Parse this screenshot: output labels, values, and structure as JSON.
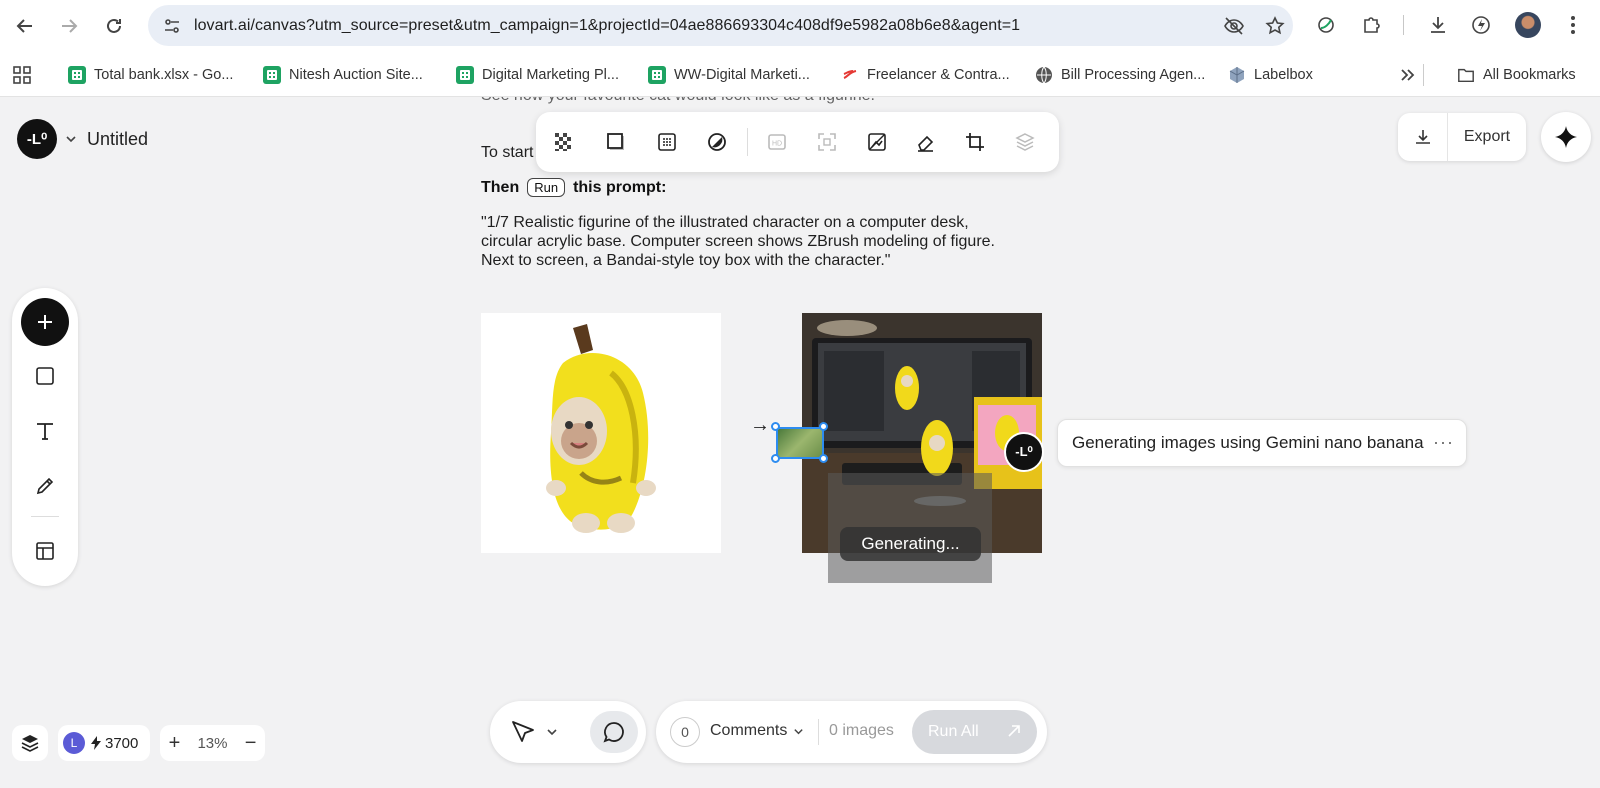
{
  "browser": {
    "url": "lovart.ai/canvas?utm_source=preset&utm_campaign=1&projectId=04ae886693304c408df9e5982a08b6e8&agent=1",
    "bookmarks": [
      {
        "label": "Total bank.xlsx - Go...",
        "icon": "sheets-icon"
      },
      {
        "label": "Nitesh Auction Site...",
        "icon": "sheets-icon"
      },
      {
        "label": "Digital Marketing Pl...",
        "icon": "sheets-icon"
      },
      {
        "label": "WW-Digital Marketi...",
        "icon": "sheets-icon"
      },
      {
        "label": "Freelancer & Contra...",
        "icon": "freelancer-icon"
      },
      {
        "label": "Bill Processing Agen...",
        "icon": "globe-icon"
      },
      {
        "label": "Labelbox",
        "icon": "labelbox-icon"
      }
    ],
    "all_bookmarks": "All Bookmarks"
  },
  "app": {
    "logo": "-L⁰",
    "project_title": "Untitled",
    "export_label": "Export"
  },
  "note": {
    "clipped_line": "See how your favourite cat would look like as a figurine.",
    "start_text": "To start",
    "then_prefix": "Then",
    "run_chip": "Run",
    "then_suffix": "this prompt:",
    "prompt": "\"1/7 Realistic figurine of the illustrated character on a computer desk, circular acrylic base. Computer screen shows ZBrush modeling of figure. Next to screen, a Bandai-style toy box with the character.\""
  },
  "canvas": {
    "generating_label": "Generating...",
    "agent_status": "Generating images using Gemini nano banana",
    "more_label": "···"
  },
  "bottom": {
    "credit_avatar": "L",
    "credits": "3700",
    "zoom": "13%",
    "comment_count": "0",
    "comments_label": "Comments",
    "images_label": "0 images",
    "run_all_label": "Run All"
  },
  "colors": {
    "selection": "#2d8cf0",
    "brand_dark": "#111111",
    "sheets_green": "#1ea362",
    "credit_avatar": "#5b5bd6"
  }
}
